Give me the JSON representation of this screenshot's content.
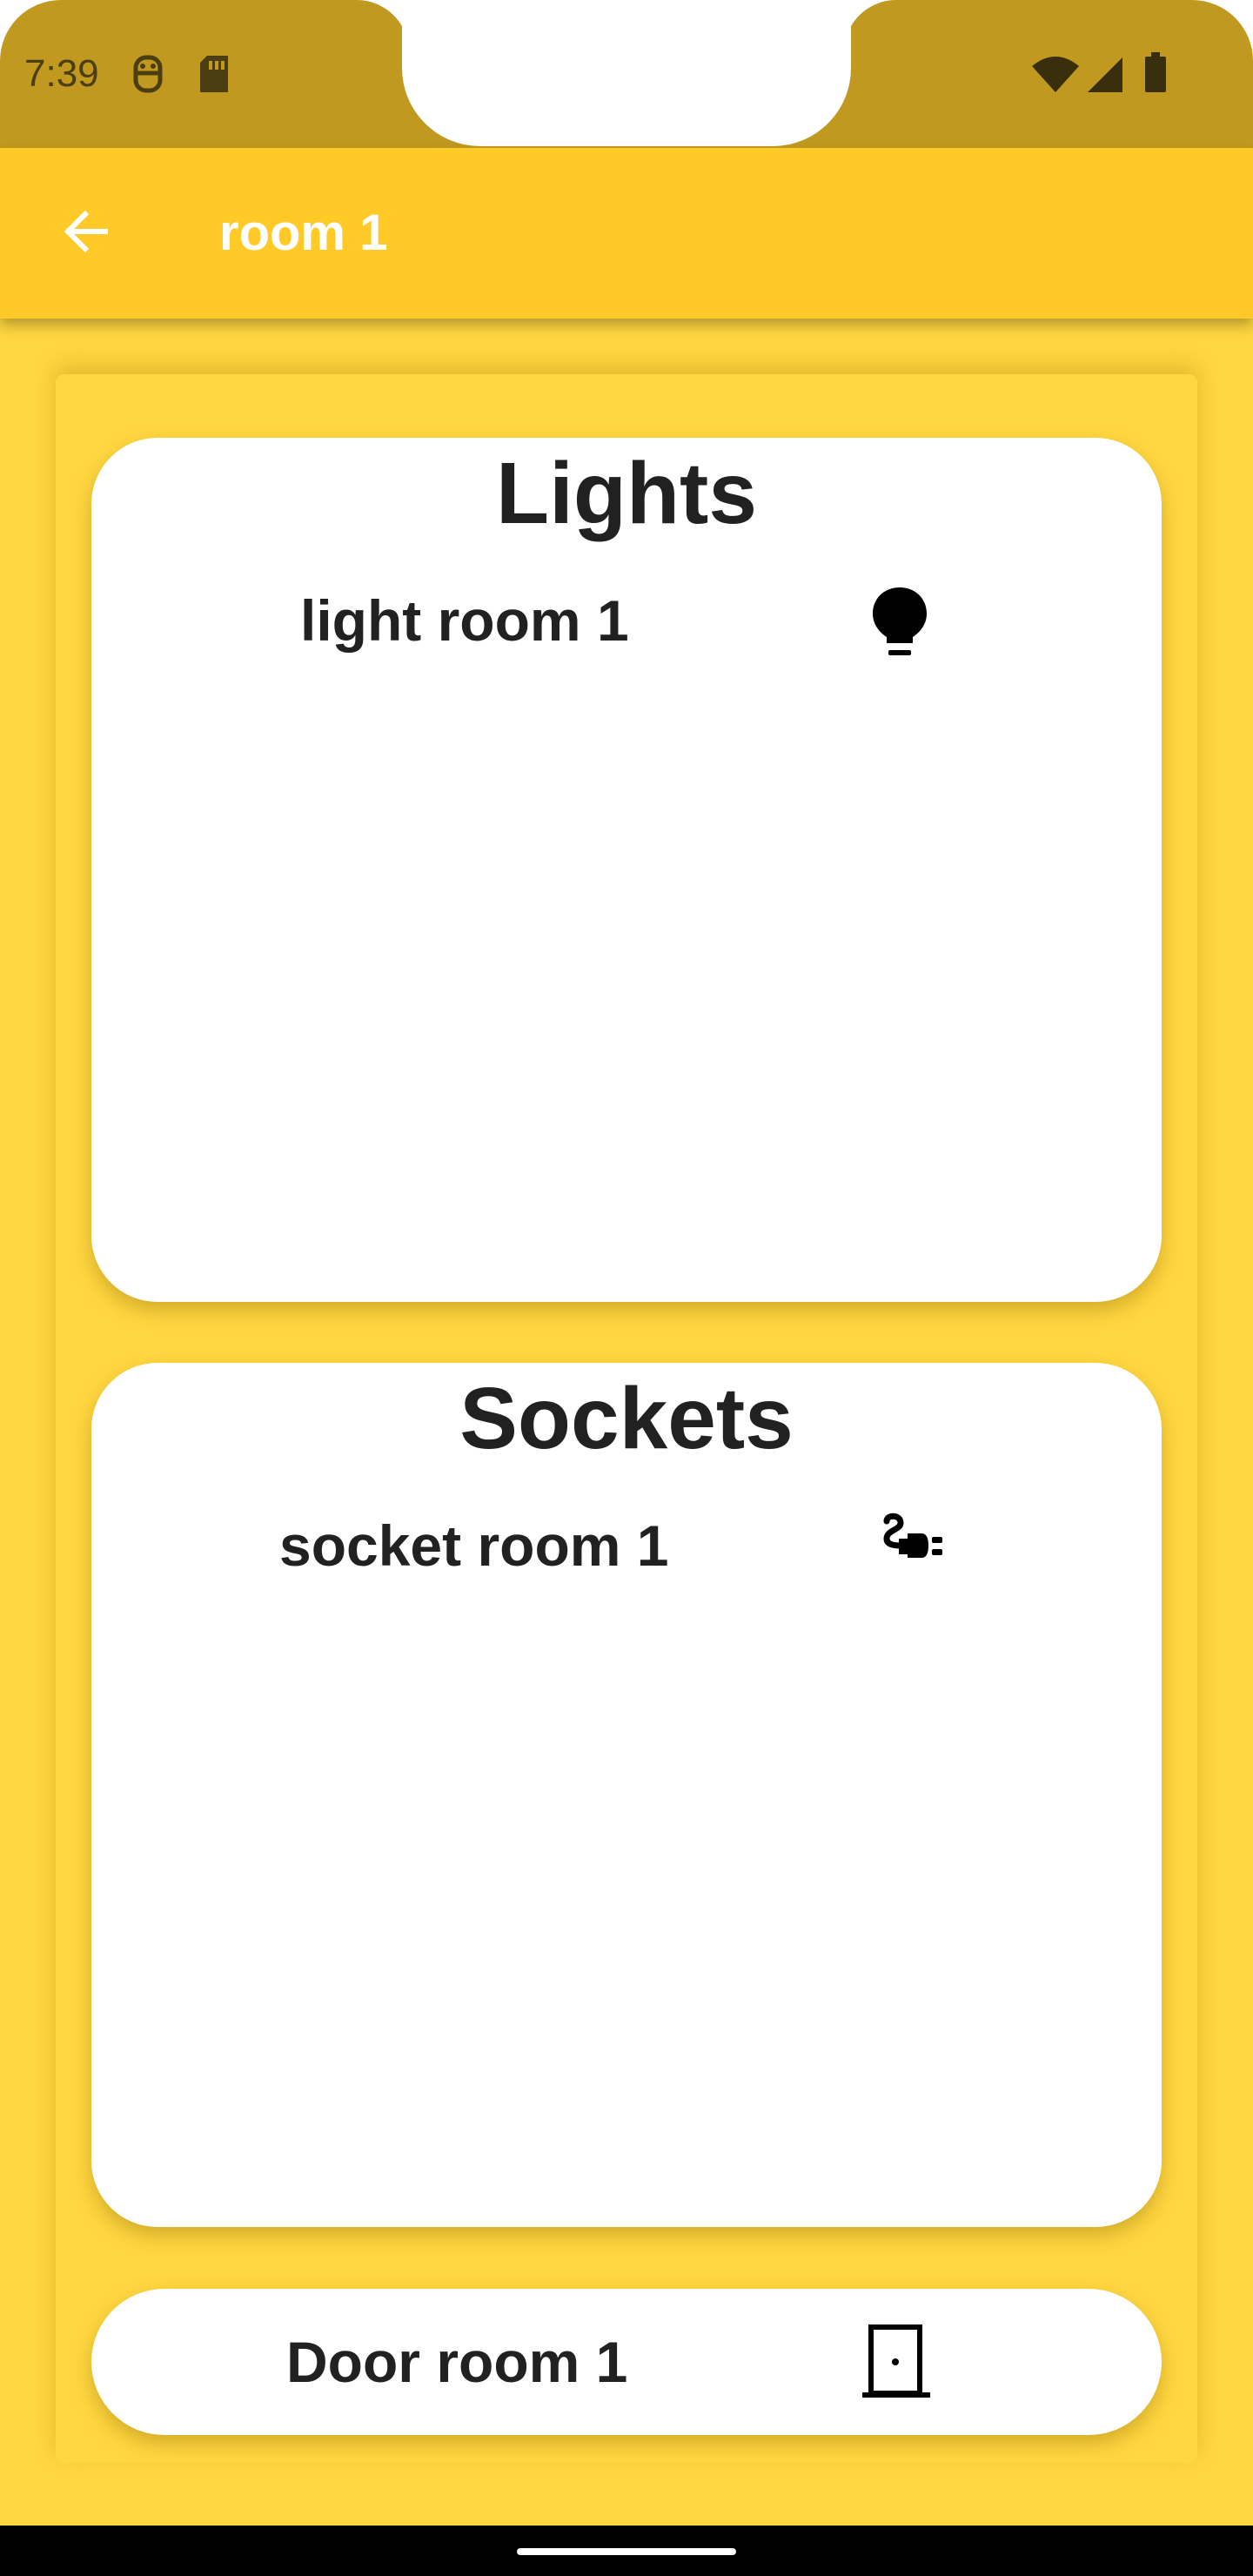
{
  "status_bar": {
    "time": "7:39",
    "icons": [
      "debug-icon",
      "sd-card-icon",
      "wifi-icon",
      "signal-icon",
      "battery-icon"
    ]
  },
  "app_bar": {
    "title": "room 1",
    "back_icon": "arrow-back-icon"
  },
  "lights": {
    "title": "Lights",
    "items": [
      {
        "label": "light room 1",
        "icon": "lightbulb-icon"
      }
    ]
  },
  "sockets": {
    "title": "Sockets",
    "items": [
      {
        "label": "socket room 1",
        "icon": "power-plug-icon"
      }
    ]
  },
  "door": {
    "label": "Door room 1",
    "icon": "door-icon"
  },
  "colors": {
    "background": "#FFD740",
    "app_bar": "#FFCA28",
    "status_bar": "#C19920",
    "card": "#FFFFFF",
    "text": "#212121"
  }
}
